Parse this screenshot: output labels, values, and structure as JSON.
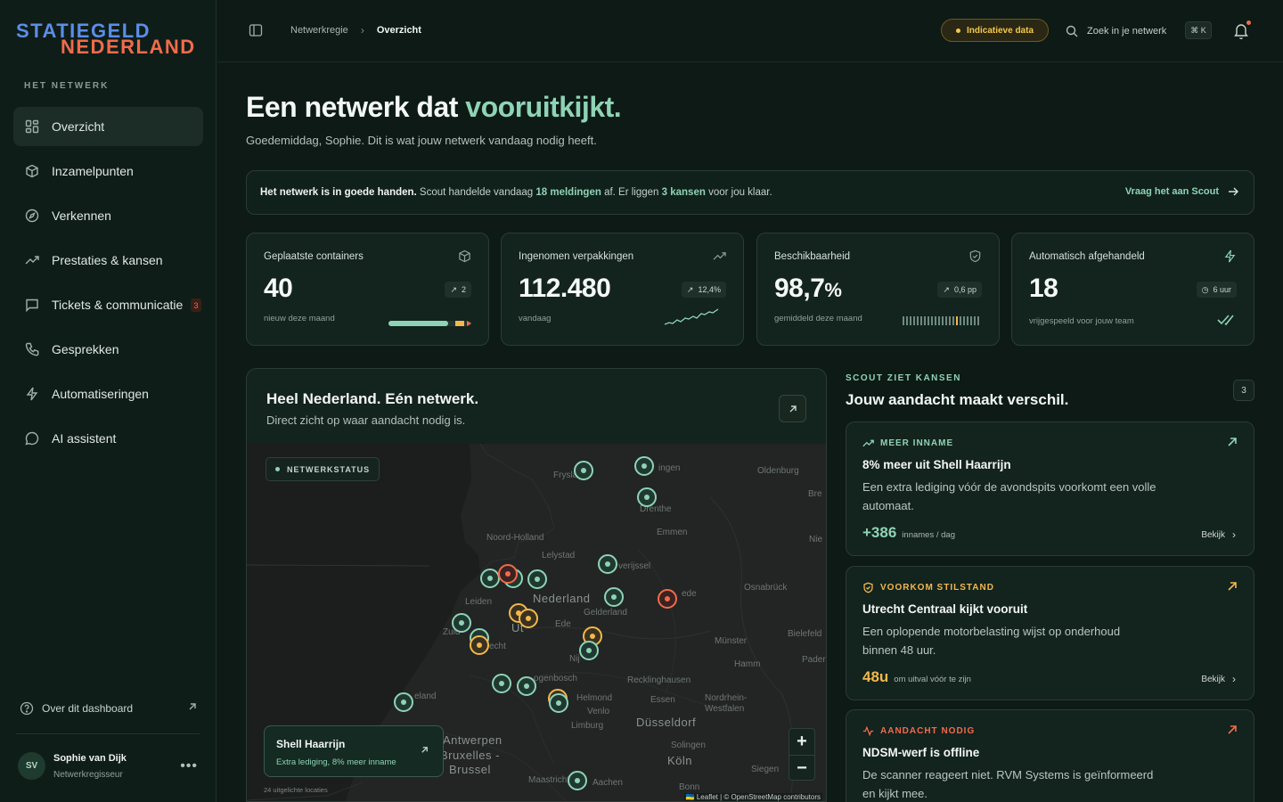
{
  "brand": {
    "line1": "STATIEGELD",
    "line2": "NEDERLAND"
  },
  "sidebar": {
    "heading": "HET NETWERK",
    "items": [
      {
        "label": "Overzicht",
        "icon": "grid-icon",
        "active": true
      },
      {
        "label": "Inzamelpunten",
        "icon": "box-icon"
      },
      {
        "label": "Verkennen",
        "icon": "compass-icon"
      },
      {
        "label": "Prestaties & kansen",
        "icon": "trend-up-icon"
      },
      {
        "label": "Tickets & communicatie",
        "icon": "message-square-icon",
        "badge": "3"
      },
      {
        "label": "Gesprekken",
        "icon": "phone-icon"
      },
      {
        "label": "Automatiseringen",
        "icon": "bolt-icon"
      },
      {
        "label": "AI assistent",
        "icon": "chat-bubble-icon"
      }
    ],
    "about_link": "Over dit dashboard",
    "profile": {
      "initials": "SV",
      "name": "Sophie van Dijk",
      "role": "Netwerkregisseur"
    }
  },
  "header": {
    "breadcrumb": [
      "Netwerkregie",
      "Overzicht"
    ],
    "indicator": "Indicatieve data",
    "search_placeholder": "Zoek in je netwerk",
    "shortcut": "⌘ K"
  },
  "hero": {
    "title_main": "Een netwerk dat ",
    "title_accent": "vooruitkijkt.",
    "subtitle": "Goedemiddag, Sophie. Dit is wat jouw netwerk vandaag nodig heeft."
  },
  "banner": {
    "bold": "Het netwerk is in goede handen.",
    "t1": " Scout handelde vandaag ",
    "h1": "18 meldingen",
    "t2": " af. Er liggen ",
    "h2": "3 kansen",
    "t3": " voor jou klaar.",
    "cta": "Vraag het aan Scout"
  },
  "kpis": [
    {
      "label": "Geplaatste containers",
      "value": "40",
      "unit": "",
      "delta": "2",
      "sub": "nieuw deze maand",
      "icon": "cube-icon",
      "progress": 0.84
    },
    {
      "label": "Ingenomen verpakkingen",
      "value": "112.480",
      "unit": "",
      "delta": "12,4%",
      "sub": "vandaag",
      "icon": "trend-up-icon"
    },
    {
      "label": "Beschikbaarheid",
      "value": "98,7",
      "unit": "%",
      "delta": "0,6 pp",
      "sub": "gemiddeld deze maand",
      "icon": "shield-check-icon"
    },
    {
      "label": "Automatisch afgehandeld",
      "value": "18",
      "unit": "",
      "delta": "6 uur",
      "sub": "vrijgespeeld voor jouw team",
      "icon": "bolt-icon"
    }
  ],
  "map": {
    "title": "Heel Nederland. Eén netwerk.",
    "subtitle": "Direct zicht op waar aandacht nodig is.",
    "status_badge": "NETWERKSTATUS",
    "labels": {
      "friesland": "Fryslân",
      "groningen": "ingen",
      "oldenburg": "Oldenburg",
      "bremen": "Bre",
      "drenthe": "Drenthe",
      "emmen": "Emmen",
      "noord_holland": "Noord-Holland",
      "lelystad": "Lelystad",
      "overijssel": "verijssel",
      "nie": "Nie",
      "nederland": "Nederland",
      "leiden": "Leiden",
      "gelderland": "Gelderland",
      "osnabruck": "Osnabrück",
      "ede": "Ede",
      "zuid": "Zuid",
      "utrecht": "Ut",
      "cht": "echt",
      "bielefeld": "Bielefeld",
      "munster": "Münster",
      "nijm": "Nij",
      "paderborn": "Pader",
      "hamm": "Hamm",
      "bosch": "ogenbosch",
      "recklinghausen": "Recklinghausen",
      "zeeland": "eland",
      "helmond": "Helmond",
      "essen": "Essen",
      "nrw": "Nordrhein-Westfalen",
      "venlo": "Venlo",
      "limburg": "Limburg",
      "dusseldorf": "Düsseldorf",
      "antwerpen": "Antwerpen",
      "bruxelles": "Bruxelles -",
      "brussel": "Brussel",
      "solingen": "Solingen",
      "koln": "Köln",
      "siegen": "Siegen",
      "maastricht": "Maastricht",
      "aachen": "Aachen",
      "bonn": "Bonn",
      "gede": "ede"
    },
    "popup": {
      "title": "Shell Haarrijn",
      "subtitle": "Extra lediging, 8% meer inname"
    },
    "footnote": "24 uitgelichte locaties",
    "attribution": "🇺🇦 Leaflet | © OpenStreetMap contributors",
    "zoom_in": "+",
    "zoom_out": "−"
  },
  "scout": {
    "tag": "SCOUT ZIET KANSEN",
    "title": "Jouw aandacht maakt verschil.",
    "count": "3",
    "cards": [
      {
        "tag": "MEER INNAME",
        "title": "8% meer uit Shell Haarrijn",
        "desc": "Een extra lediging vóór de avondspits voorkomt een volle automaat.",
        "metric": "+386",
        "metric_unit": "innames / dag",
        "look": "Bekijk",
        "color": "#8fd3b5"
      },
      {
        "tag": "VOORKOM STILSTAND",
        "title": "Utrecht Centraal kijkt vooruit",
        "desc": "Een oplopende motorbelasting wijst op onderhoud binnen 48 uur.",
        "metric": "48u",
        "metric_unit": "om uitval vóór te zijn",
        "look": "Bekijk",
        "color": "#f2b84c"
      },
      {
        "tag": "AANDACHT NODIG",
        "title": "NDSM-werf is offline",
        "desc": "De scanner reageert niet. RVM Systems is geïnformeerd en kijkt mee.",
        "color": "#f26b4b"
      }
    ]
  }
}
